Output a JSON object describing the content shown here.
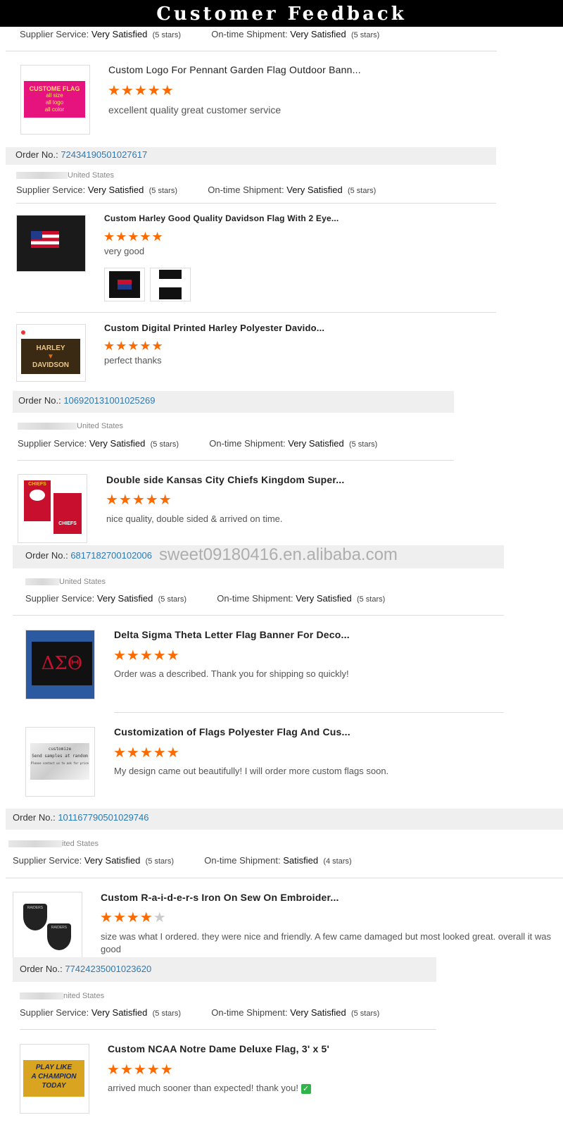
{
  "header": {
    "title": "Customer Feedback"
  },
  "labels": {
    "supplier": "Supplier Service:",
    "shipment": "On-time Shipment:",
    "order": "Order No.:"
  },
  "rating_values": {
    "very_satisfied": "Very Satisfied",
    "satisfied": "Satisfied",
    "five": "(5 stars)",
    "four": "(4 stars)"
  },
  "country": {
    "us": "United States",
    "us_partial": "ited States",
    "us_partial2": "nited States"
  },
  "orders": [
    "72434190501027617",
    "106920131001025269",
    "6817182700102006",
    "101167790501029746",
    "77424235001023620"
  ],
  "reviews": [
    {
      "title": "Custom Logo For Pennant Garden Flag Outdoor Bann...",
      "stars": 5,
      "comment": "excellent quality great customer service",
      "thumb_text": [
        "CUSTOME FLAG",
        "all size",
        "all logo",
        "all color"
      ]
    },
    {
      "title": "Custom Harley Good Quality Davidson Flag With 2 Eye...",
      "stars": 5,
      "comment": "very good"
    },
    {
      "title": "Custom Digital Printed Harley Polyester Davido...",
      "stars": 5,
      "comment": "perfect thanks",
      "thumb_text": [
        "HARLEY",
        "DAVIDSON"
      ]
    },
    {
      "title": "Double side Kansas City Chiefs Kingdom Super...",
      "stars": 5,
      "comment": "nice quality, double sided & arrived on time.",
      "thumb_text": [
        "CHIEFS",
        "CHIEFS"
      ]
    },
    {
      "title": "Delta Sigma Theta Letter Flag Banner For Deco...",
      "stars": 5,
      "comment": "Order was a described.  Thank you for shipping so quickly!",
      "thumb_text": [
        "ΔΣΘ"
      ]
    },
    {
      "title": "Customization of Flags Polyester Flag And Cus...",
      "stars": 5,
      "comment": "My design came out beautifully! I will order more custom flags soon.",
      "thumb_text": [
        "customize",
        "Send samples at random",
        "Please contact us to ask for price"
      ]
    },
    {
      "title": "Custom R-a-i-d-e-r-s Iron On Sew On Embroider...",
      "stars": 4,
      "comment": "size was what I ordered. they were nice and friendly. A few came damaged but most looked great. overall it was good",
      "thumb_text": [
        "RAIDERS",
        "RAIDERS"
      ]
    },
    {
      "title": "Custom NCAA Notre Dame Deluxe Flag, 3' x 5'",
      "stars": 5,
      "comment": "arrived much sooner than expected! thank you!",
      "thumb_text": [
        "PLAY LIKE",
        "A CHAMPION",
        "TODAY"
      ]
    }
  ],
  "watermark": "sweet09180416.en.alibaba.com",
  "colors": {
    "star": "#ff6a00",
    "link": "#2a7ab6",
    "bar": "#efefef"
  }
}
